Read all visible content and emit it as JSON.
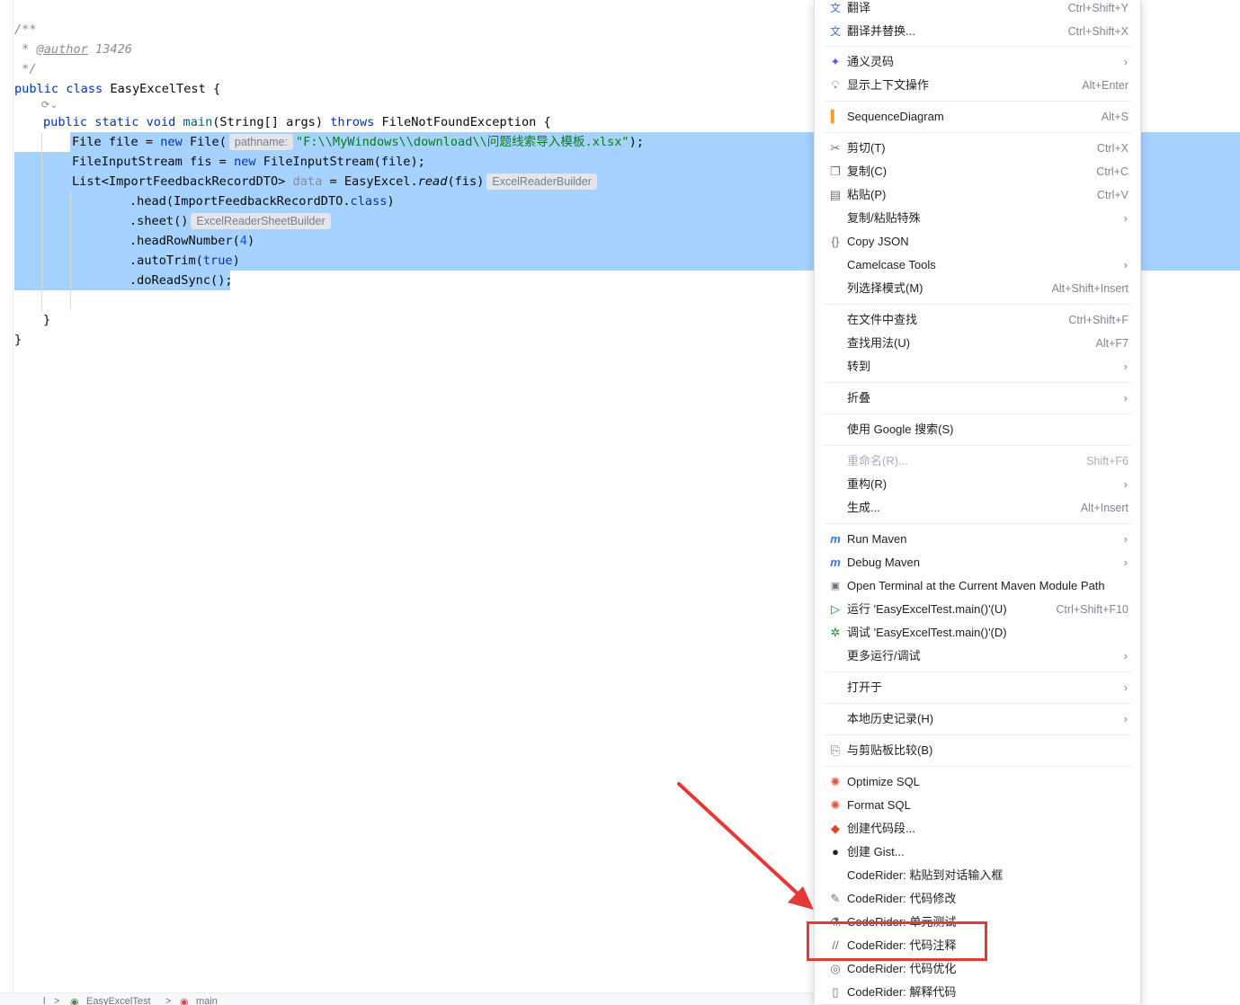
{
  "editor": {
    "comment_open": "/**",
    "comment_author_prefix": " * ",
    "comment_author_tag": "@author",
    "comment_author_value": " 13426",
    "comment_close": " */",
    "class_kw": "public class",
    "class_name": " EasyExcelTest {",
    "method_kw1": "public static void",
    "method_name": " main",
    "method_params": "(String[] args) ",
    "method_throws": "throws",
    "method_exc": " FileNotFoundException {",
    "line_file_a": "File file = ",
    "line_file_new": "new",
    "line_file_b": " File(",
    "hint_pathname": "pathname:",
    "line_file_str": "\"F:\\\\MyWindows\\\\download\\\\问题线索导入模板.xlsx\"",
    "line_file_end": ");",
    "line_fis_a": "FileInputStream fis = ",
    "line_fis_new": "new",
    "line_fis_b": " FileInputStream(file);",
    "line_list_a": "List<ImportFeedbackRecordDTO> ",
    "line_list_var": "data",
    "line_list_b": " = EasyExcel.",
    "line_list_read": "read",
    "line_list_c": "(fis)",
    "hint_reader_builder": "ExcelReaderBuilder",
    "line_head": ".head(ImportFeedbackRecordDTO.",
    "line_head_class": "class",
    "line_head_end": ")",
    "line_sheet": ".sheet()",
    "hint_sheet_builder": "ExcelReaderSheetBuilder",
    "line_headrow": ".headRowNumber(",
    "line_headrow_num": "4",
    "line_headrow_end": ")",
    "line_autotrim": ".autoTrim(",
    "line_autotrim_val": "true",
    "line_autotrim_end": ")",
    "line_doread": ".doReadSync();",
    "close_method": "}",
    "close_class": "}"
  },
  "breadcrumb": {
    "items": [
      "l",
      ">",
      "EasyExcelTest",
      ">",
      "main"
    ]
  },
  "menu": {
    "items": [
      {
        "icon": "translate-icon",
        "label": "翻译",
        "shortcut": "Ctrl+Shift+Y"
      },
      {
        "icon": "translate-replace-icon",
        "label": "翻译并替换...",
        "shortcut": "Ctrl+Shift+X"
      },
      {
        "icon": "tongyi-icon",
        "label": "通义灵码",
        "shortcut": "",
        "submenu": true
      },
      {
        "icon": "bulb-icon",
        "label": "显示上下文操作",
        "shortcut": "Alt+Enter"
      },
      {
        "icon": "sequence-diagram-icon",
        "label": "SequenceDiagram",
        "shortcut": "Alt+S"
      },
      {
        "icon": "scissors-icon",
        "label": "剪切(T)",
        "shortcut": "Ctrl+X"
      },
      {
        "icon": "copy-icon",
        "label": "复制(C)",
        "shortcut": "Ctrl+C"
      },
      {
        "icon": "paste-icon",
        "label": "粘贴(P)",
        "shortcut": "Ctrl+V"
      },
      {
        "icon": "",
        "label": "复制/粘贴特殊",
        "shortcut": "",
        "submenu": true
      },
      {
        "icon": "json-braces-icon",
        "label": "Copy JSON",
        "shortcut": ""
      },
      {
        "icon": "",
        "label": "Camelcase Tools",
        "shortcut": "",
        "submenu": true
      },
      {
        "icon": "",
        "label": "列选择模式(M)",
        "shortcut": "Alt+Shift+Insert"
      },
      {
        "icon": "",
        "label": "在文件中查找",
        "shortcut": "Ctrl+Shift+F"
      },
      {
        "icon": "",
        "label": "查找用法(U)",
        "shortcut": "Alt+F7"
      },
      {
        "icon": "",
        "label": "转到",
        "shortcut": "",
        "submenu": true
      },
      {
        "icon": "",
        "label": "折叠",
        "shortcut": "",
        "submenu": true
      },
      {
        "icon": "",
        "label": "使用 Google 搜索(S)",
        "shortcut": ""
      },
      {
        "icon": "",
        "label": "重命名(R)...",
        "shortcut": "Shift+F6",
        "disabled": true
      },
      {
        "icon": "",
        "label": "重构(R)",
        "shortcut": "",
        "submenu": true
      },
      {
        "icon": "",
        "label": "生成...",
        "shortcut": "Alt+Insert"
      },
      {
        "icon": "maven-run-icon",
        "label": "Run Maven",
        "shortcut": "",
        "submenu": true
      },
      {
        "icon": "maven-debug-icon",
        "label": "Debug Maven",
        "shortcut": "",
        "submenu": true
      },
      {
        "icon": "terminal-icon",
        "label": "Open Terminal at the Current Maven Module Path",
        "shortcut": ""
      },
      {
        "icon": "run-triangle-icon",
        "label": "运行 'EasyExcelTest.main()'(U)",
        "shortcut": "Ctrl+Shift+F10"
      },
      {
        "icon": "debug-bug-icon",
        "label": "调试 'EasyExcelTest.main()'(D)",
        "shortcut": ""
      },
      {
        "icon": "",
        "label": "更多运行/调试",
        "shortcut": "",
        "submenu": true
      },
      {
        "icon": "",
        "label": "打开于",
        "shortcut": "",
        "submenu": true
      },
      {
        "icon": "",
        "label": "本地历史记录(H)",
        "shortcut": "",
        "submenu": true
      },
      {
        "icon": "compare-clipboard-icon",
        "label": "与剪贴板比较(B)",
        "shortcut": ""
      },
      {
        "icon": "crab-sql-icon",
        "label": "Optimize SQL",
        "shortcut": ""
      },
      {
        "icon": "crab-sql-icon",
        "label": "Format SQL",
        "shortcut": ""
      },
      {
        "icon": "gitlab-icon",
        "label": "创建代码段...",
        "shortcut": ""
      },
      {
        "icon": "github-icon",
        "label": "创建 Gist...",
        "shortcut": ""
      },
      {
        "icon": "",
        "label": "CodeRider: 粘贴到对话输入框",
        "shortcut": ""
      },
      {
        "icon": "pencil-icon",
        "label": "CodeRider: 代码修改",
        "shortcut": ""
      },
      {
        "icon": "test-flask-icon",
        "label": "CodeRider: 单元测试",
        "shortcut": ""
      },
      {
        "icon": "comment-slash-icon",
        "label": "CodeRider: 代码注释",
        "shortcut": ""
      },
      {
        "icon": "optimize-eye-icon",
        "label": "CodeRider: 代码优化",
        "shortcut": ""
      },
      {
        "icon": "book-icon",
        "label": "CodeRider: 解释代码",
        "shortcut": ""
      }
    ]
  },
  "colors": {
    "selection": "#a6d2ff",
    "annotation_red": "#e53935",
    "keyword": "#0033b3",
    "string": "#067d17"
  }
}
